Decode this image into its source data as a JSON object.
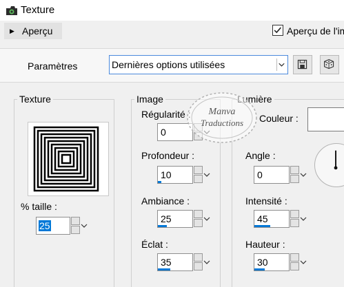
{
  "window": {
    "title": "Texture"
  },
  "preview": {
    "label": "Aperçu",
    "live_label": "Aperçu de l'im",
    "live_checked": true
  },
  "params": {
    "label": "Paramètres",
    "preset_value": "Dernières options utilisées"
  },
  "groups": {
    "texture": {
      "title": "Texture",
      "size_label": "% taille :",
      "size_value": "25"
    },
    "image": {
      "title": "Image",
      "regularity_label": "Régularité :",
      "regularity_value": "0",
      "depth_label": "Profondeur :",
      "depth_value": "10",
      "ambiance_label": "Ambiance :",
      "ambiance_value": "25",
      "shine_label": "Éclat :",
      "shine_value": "35"
    },
    "light": {
      "title": "Lumière",
      "color_label": "Couleur :",
      "color_value": "#ffffff",
      "angle_label": "Angle :",
      "angle_value": "0",
      "intensity_label": "Intensité :",
      "intensity_value": "45",
      "height_label": "Hauteur :",
      "height_value": "30"
    }
  },
  "watermark": {
    "line1": "Manva",
    "line2": "Traductions"
  },
  "colors": {
    "accent": "#0078d7",
    "focus_border": "#4a89dc",
    "select_highlight": "#0078d7"
  },
  "icons": [
    "app-icon",
    "chevron-right-icon",
    "check-icon",
    "chevron-down-icon",
    "save-icon",
    "dice-icon",
    "spin-up-icon",
    "spin-down-icon"
  ]
}
